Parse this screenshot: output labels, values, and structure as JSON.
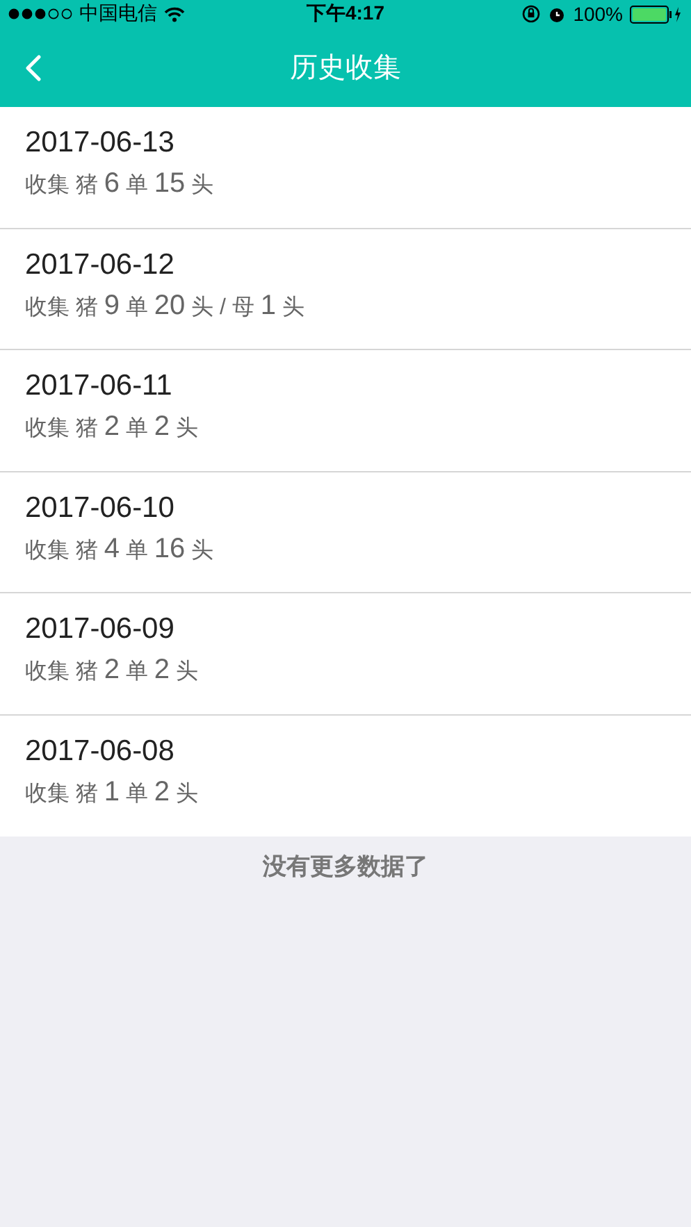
{
  "status_bar": {
    "carrier": "中国电信",
    "time": "下午4:17",
    "battery": "100%"
  },
  "nav": {
    "back": true,
    "title": "历史收集"
  },
  "records": [
    {
      "date": "2017-06-13",
      "summary": "收集 猪 6 单 15 头"
    },
    {
      "date": "2017-06-12",
      "summary": "收集 猪 9 单 20 头 / 母 1 头"
    },
    {
      "date": "2017-06-11",
      "summary": "收集 猪 2 单 2 头"
    },
    {
      "date": "2017-06-10",
      "summary": "收集 猪 4 单 16 头"
    },
    {
      "date": "2017-06-09",
      "summary": "收集 猪 2 单 2 头"
    },
    {
      "date": "2017-06-08",
      "summary": "收集 猪 1 单 2 头"
    }
  ],
  "footer": "没有更多数据了"
}
